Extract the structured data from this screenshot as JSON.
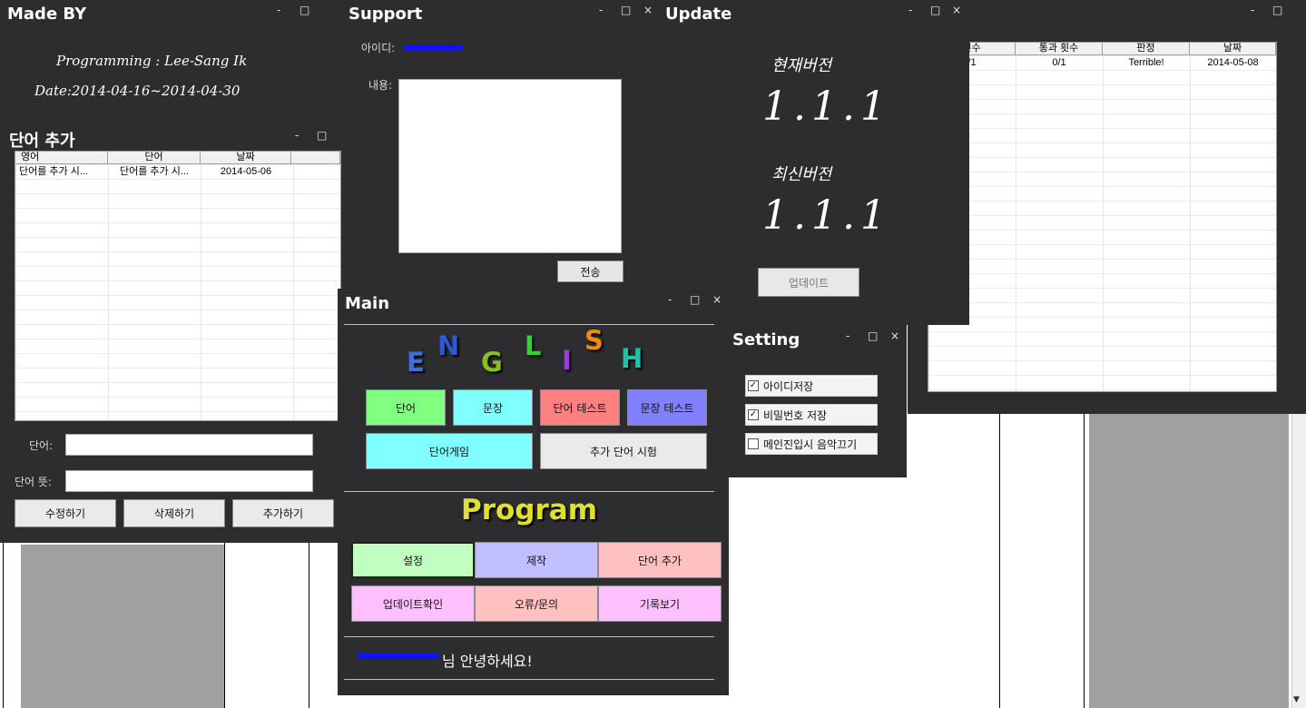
{
  "window_controls": {
    "minimize": "-",
    "maximize": "□",
    "close": "×"
  },
  "made_by": {
    "title": "Made BY",
    "programming": "Programming : Lee-Sang Ik",
    "date": "Date:2014-04-16~2014-04-30"
  },
  "support": {
    "title": "Support",
    "id_label": "아이디:",
    "content_label": "내용:",
    "send_button": "전송"
  },
  "update": {
    "title": "Update",
    "current_label": "현재버전",
    "current_version": "1.1.1",
    "latest_label": "최신버전",
    "latest_version": "1.1.1",
    "update_button": "업데이트"
  },
  "history": {
    "columns": [
      "횟수",
      "통과 횟수",
      "판정",
      "날짜"
    ],
    "rows": [
      [
        "/1",
        "0/1",
        "Terrible!",
        "2014-05-08"
      ]
    ]
  },
  "add_word": {
    "title": "단어 추가",
    "columns": [
      "영어",
      "단어",
      "날짜"
    ],
    "rows": [
      [
        "단어를 추가 시...",
        "단어를 추가 시...",
        "2014-05-06"
      ]
    ],
    "word_label": "단어:",
    "meaning_label": "단어 뜻:",
    "word_value": "",
    "meaning_value": "",
    "edit_button": "수정하기",
    "delete_button": "삭제하기",
    "add_button": "추가하기"
  },
  "main": {
    "title": "Main",
    "english_letters": [
      {
        "char": "E",
        "color": "#3a6fe0"
      },
      {
        "char": "N",
        "color": "#2a58d8"
      },
      {
        "char": "G",
        "color": "#86c21a"
      },
      {
        "char": "L",
        "color": "#32d232"
      },
      {
        "char": "I",
        "color": "#a23ad8"
      },
      {
        "char": "S",
        "color": "#f08a10"
      },
      {
        "char": "H",
        "color": "#22c0a8"
      }
    ],
    "word_button": "단어",
    "sentence_button": "문장",
    "word_test_button": "단어 테스트",
    "sentence_test_button": "문장 테스트",
    "word_game_button": "단어게임",
    "added_word_test_button": "추가 단어 시험",
    "program_heading": "Program",
    "settings_button": "설정",
    "credits_button": "제작",
    "add_word_button": "단어 추가",
    "update_check_button": "업데이트확인",
    "error_inquiry_button": "오류/문의",
    "records_button": "기록보기",
    "greeting": "님 안녕하세요!",
    "colors": {
      "green": "#80ff80",
      "cyan": "#80ffff",
      "red": "#ff8080",
      "blue": "#8080ff",
      "light_green": "#c0ffc0",
      "lavender": "#c0c0ff",
      "pink": "#ffc0c0",
      "violet": "#ffc0ff",
      "heading": "#e0e030"
    }
  },
  "setting": {
    "title": "Setting",
    "options": [
      {
        "label": "아이디저장",
        "checked": true,
        "mark": "✓"
      },
      {
        "label": "비밀번호 저장",
        "checked": true,
        "mark": "✓"
      },
      {
        "label": "메인진입시 음악끄기",
        "checked": false,
        "mark": ""
      }
    ]
  }
}
